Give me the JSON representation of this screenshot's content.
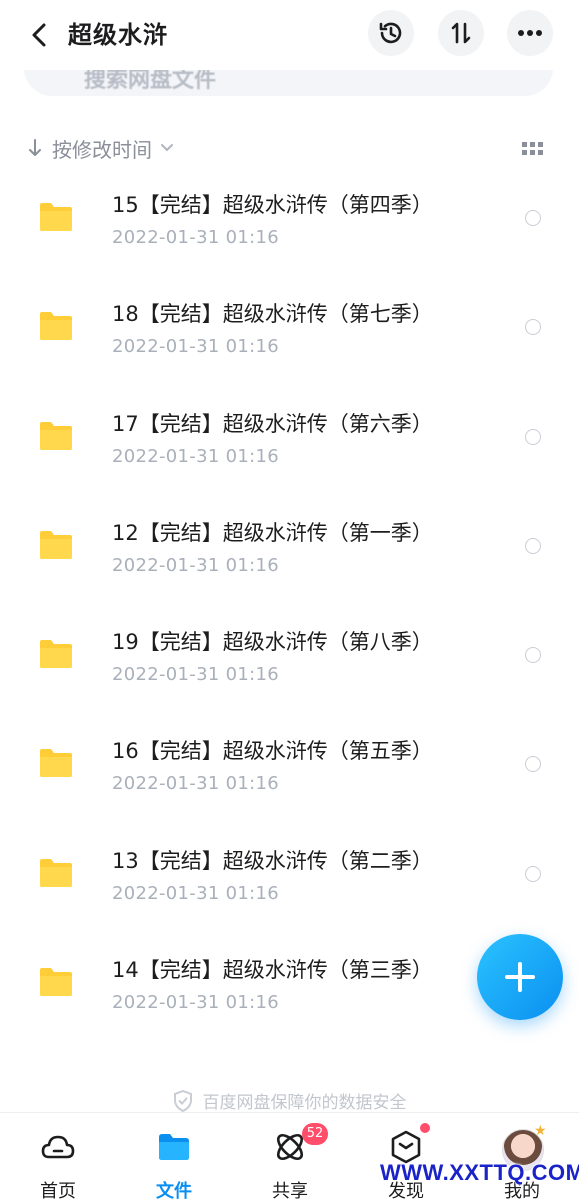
{
  "header": {
    "title": "超级水浒"
  },
  "search": {
    "placeholder": "搜索网盘文件"
  },
  "sort": {
    "label": "按修改时间"
  },
  "files": [
    {
      "name": "15【完结】超级水浒传（第四季）",
      "date": "2022-01-31  01:16"
    },
    {
      "name": "18【完结】超级水浒传（第七季）",
      "date": "2022-01-31  01:16"
    },
    {
      "name": "17【完结】超级水浒传（第六季）",
      "date": "2022-01-31  01:16"
    },
    {
      "name": "12【完结】超级水浒传（第一季）",
      "date": "2022-01-31  01:16"
    },
    {
      "name": "19【完结】超级水浒传（第八季）",
      "date": "2022-01-31  01:16"
    },
    {
      "name": "16【完结】超级水浒传（第五季）",
      "date": "2022-01-31  01:16"
    },
    {
      "name": "13【完结】超级水浒传（第二季）",
      "date": "2022-01-31  01:16"
    },
    {
      "name": "14【完结】超级水浒传（第三季）",
      "date": "2022-01-31  01:16"
    }
  ],
  "footer_note": "百度网盘保障你的数据安全",
  "tabs": [
    {
      "label": "首页",
      "icon": "cloud-icon"
    },
    {
      "label": "文件",
      "icon": "folder-icon"
    },
    {
      "label": "共享",
      "icon": "share-atom-icon",
      "badge": "52"
    },
    {
      "label": "发现",
      "icon": "discover-cube-icon"
    },
    {
      "label": "我的",
      "icon": "avatar"
    }
  ],
  "watermark": "WWW.XXTTQ.COM",
  "colors": {
    "accent": "#0a8ff0",
    "folder": "#ffcd38",
    "badge": "#ff4d6a"
  }
}
